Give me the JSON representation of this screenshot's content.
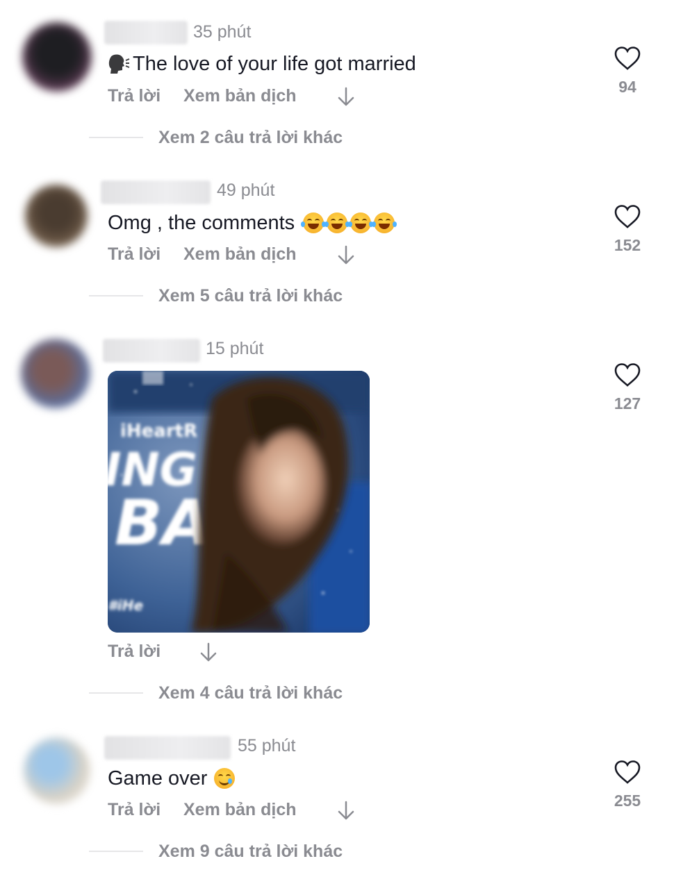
{
  "comments": [
    {
      "time": "35 phút",
      "text": "The love of your life got married",
      "reply_label": "Trả lời",
      "translate_label": "Xem bản dịch",
      "likes": "94",
      "view_replies": "Xem 2 câu trả lời khác"
    },
    {
      "time": "49 phút",
      "text": "Omg , the comments",
      "reply_label": "Trả lời",
      "translate_label": "Xem bản dịch",
      "likes": "152",
      "view_replies": "Xem 5 câu trả lời khác"
    },
    {
      "time": "15 phút",
      "gif_texts": [
        "iHeartR",
        "ING",
        "BA",
        "#iHe"
      ],
      "reply_label": "Trả lời",
      "likes": "127",
      "view_replies": "Xem 4 câu trả lời khác"
    },
    {
      "time": "55 phút",
      "text": "Game over",
      "reply_label": "Trả lời",
      "translate_label": "Xem bản dịch",
      "likes": "255",
      "view_replies": "Xem 9 câu trả lời khác"
    }
  ],
  "icons": {
    "like": "heart-outline-icon",
    "translate_arrow": "arrow-down-icon",
    "speaking": "speaking-head-icon",
    "emoji_laugh": "tears-of-joy-emoji",
    "emoji_smile_tear": "smiling-face-with-tear-emoji"
  },
  "colors": {
    "text": "#161823",
    "secondary": "#8a8b91",
    "divider": "#e6e6e8"
  }
}
